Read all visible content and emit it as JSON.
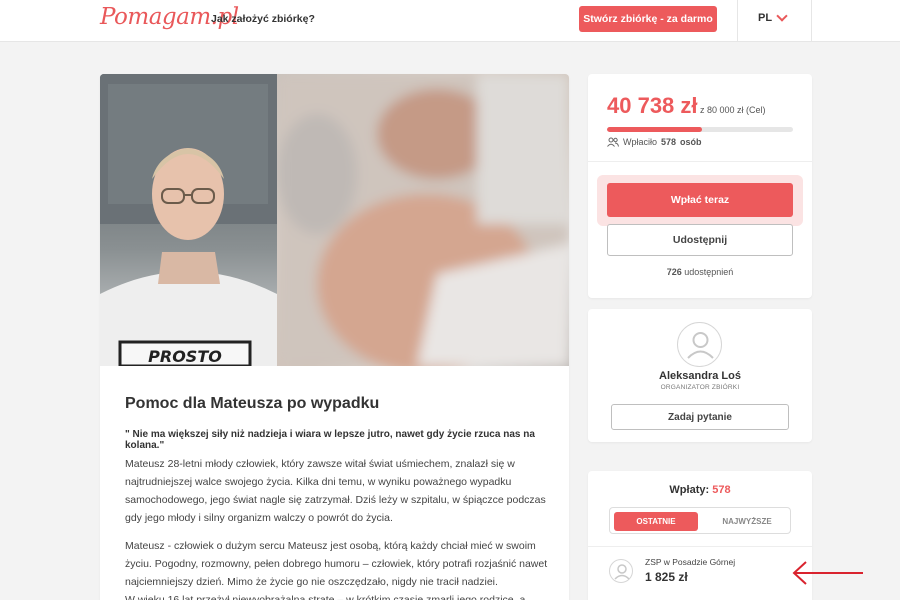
{
  "header": {
    "logo": "Pomagam.pl",
    "how_link": "Jak założyć zbiórkę?",
    "create_button": "Stwórz zbiórkę - za darmo",
    "language": "PL"
  },
  "campaign": {
    "title": "Pomoc dla Mateusza po wypadku",
    "quote": "\" Nie ma większej siły niż nadzieja i wiara w lepsze jutro, nawet gdy życie rzuca nas na kolana.\"",
    "paragraphs": [
      " Mateusz 28-letni młody człowiek, który zawsze witał świat uśmiechem, znalazł się w najtrudniejszej walce swojego życia. Kilka dni temu, w wyniku poważnego wypadku samochodowego, jego świat nagle się zatrzymał. Dziś leży w szpitalu, w śpiączce podczas gdy jego młody i silny organizm walczy o powrót do życia.",
      " Mateusz - człowiek o dużym sercu Mateusz jest osobą, którą każdy chciał mieć w swoim życiu. Pogodny, rozmowny, pełen dobrego humoru – człowiek, który potrafi rozjaśnić nawet najciemniejszy dzień. Mimo że życie go nie oszczędzało, nigdy nie tracił nadziei.",
      " W wieku 16 lat przeżył niewyobrażalną stratę – w krótkim czasie zmarli jego rodzice, a"
    ],
    "shirt_text": "PROSTO"
  },
  "funding": {
    "amount": "40 738 zł",
    "goal_text": "z 80 000 zł (Cel)",
    "progress": 0.51,
    "donors_label": "Wpłaciło",
    "donors_count": "578",
    "donors_suffix": "osób",
    "pay_button": "Wpłać teraz",
    "share_button": "Udostępnij",
    "share_count": "726",
    "share_suffix": "udostępnień"
  },
  "organizer": {
    "name": "Aleksandra Loś",
    "role": "ORGANIZATOR ZBIÓRKI",
    "ask_button": "Zadaj pytanie"
  },
  "payments": {
    "title": "Wpłaty:",
    "count": "578",
    "tabs": [
      "OSTATNIE",
      "NAJWYŻSZE"
    ],
    "items": [
      {
        "name": "ZSP w Posadzie Górnej",
        "amount": "1 825 zł"
      }
    ]
  },
  "colors": {
    "accent": "#ed5a5c",
    "annotation_arrow": "#d9232e"
  },
  "icons": {
    "language_chevron": "chevron-down-icon",
    "donors": "users-icon",
    "avatar": "user-avatar-icon",
    "annotation": "arrow-left-icon"
  }
}
